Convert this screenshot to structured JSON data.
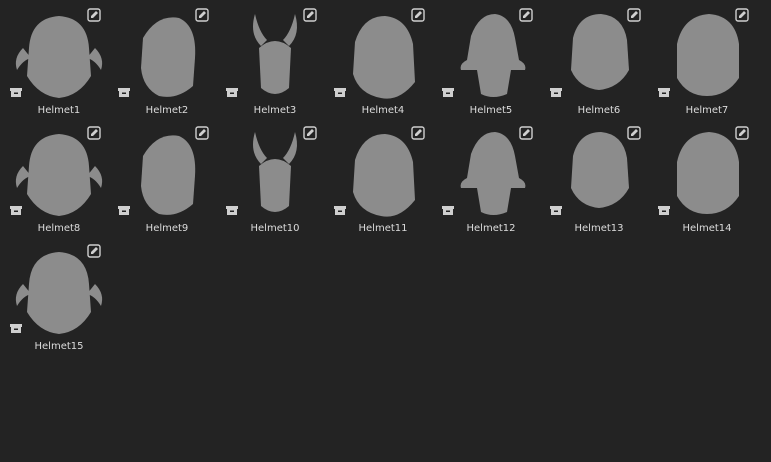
{
  "assets": [
    {
      "name": "Helmet1",
      "icon": "helmet-thumbnail-icon"
    },
    {
      "name": "Helmet2",
      "icon": "helmet-thumbnail-icon"
    },
    {
      "name": "Helmet3",
      "icon": "helmet-thumbnail-icon"
    },
    {
      "name": "Helmet4",
      "icon": "helmet-thumbnail-icon"
    },
    {
      "name": "Helmet5",
      "icon": "helmet-thumbnail-icon"
    },
    {
      "name": "Helmet6",
      "icon": "helmet-thumbnail-icon"
    },
    {
      "name": "Helmet7",
      "icon": "helmet-thumbnail-icon"
    },
    {
      "name": "Helmet8",
      "icon": "helmet-thumbnail-icon"
    },
    {
      "name": "Helmet9",
      "icon": "helmet-thumbnail-icon"
    },
    {
      "name": "Helmet10",
      "icon": "helmet-thumbnail-icon"
    },
    {
      "name": "Helmet11",
      "icon": "helmet-thumbnail-icon"
    },
    {
      "name": "Helmet12",
      "icon": "helmet-thumbnail-icon"
    },
    {
      "name": "Helmet13",
      "icon": "helmet-thumbnail-icon"
    },
    {
      "name": "Helmet14",
      "icon": "helmet-thumbnail-icon"
    },
    {
      "name": "Helmet15",
      "icon": "helmet-thumbnail-icon"
    }
  ],
  "colors": {
    "background": "#232323",
    "label_text": "#dcdcdc",
    "thumbnail_fill": "#8c8c8c",
    "button_icon": "#cfcfcf"
  }
}
